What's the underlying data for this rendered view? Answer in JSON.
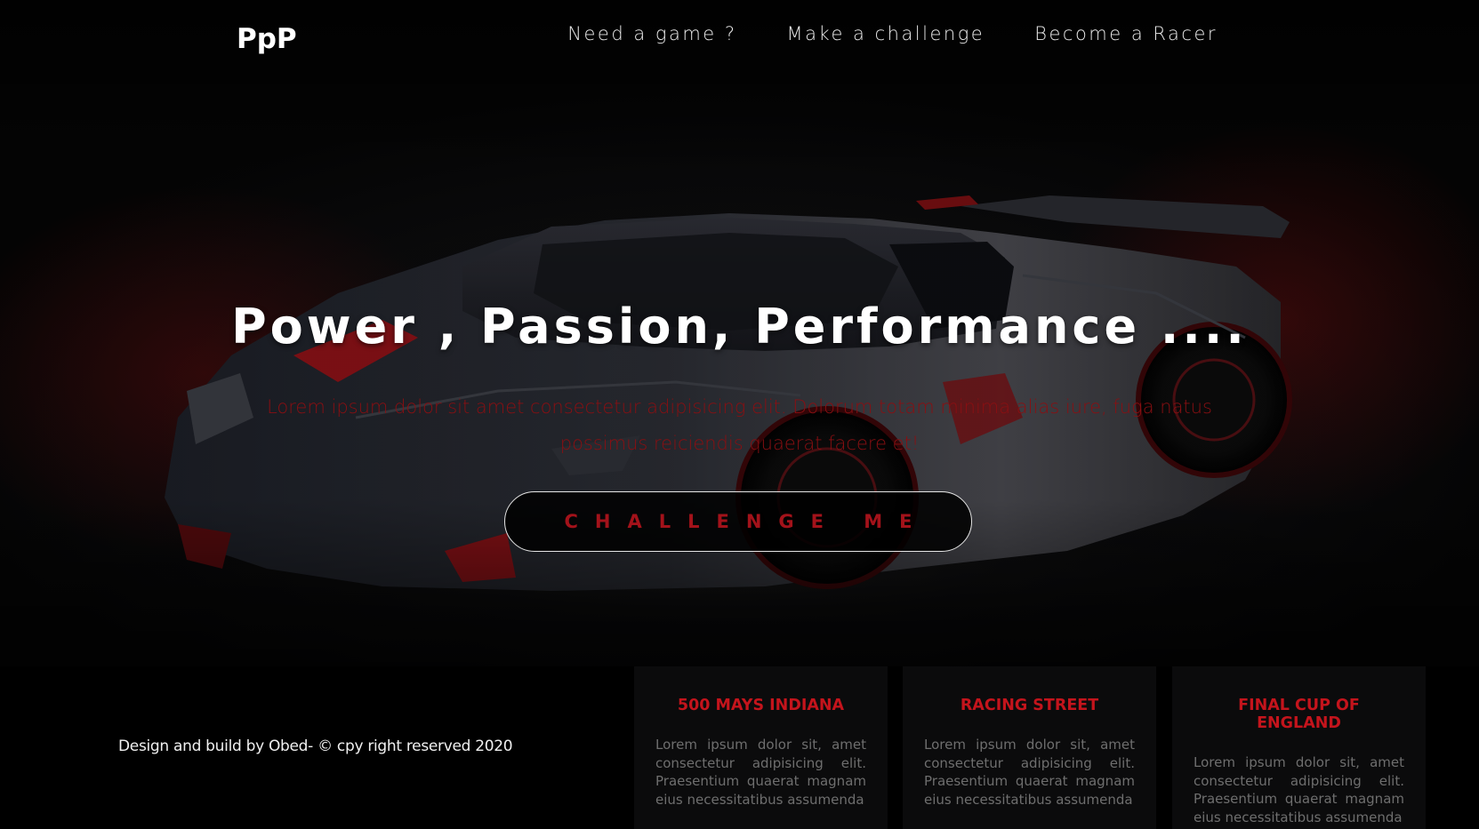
{
  "brand": {
    "logo": "PpP"
  },
  "nav": {
    "items": [
      {
        "label": "Need a game ?"
      },
      {
        "label": "Make a challenge"
      },
      {
        "label": "Become a Racer"
      }
    ]
  },
  "hero": {
    "headline": "Power , Passion, Performance ....",
    "subtext": "Lorem ipsum dolor sit amet consectetur adipisicing elit. Dolorum totam minima alias iure, fuga natus possimus reiciendis quaerat facere et!",
    "cta_label": "CHALLENGE ME",
    "background_image": "sports-car-image"
  },
  "footer": {
    "credit": "Design and build by Obed- © cpy right reserved 2020",
    "cards": [
      {
        "title": "500 MAYS INDIANA",
        "body": "Lorem ipsum dolor sit, amet consectetur adipisicing elit. Praesentium quaerat magnam eius necessitatibus assumenda"
      },
      {
        "title": "RACING STREET",
        "body": "Lorem ipsum dolor sit, amet consectetur adipisicing elit. Praesentium quaerat magnam eius necessitatibus assumenda"
      },
      {
        "title": "FINAL CUP OF ENGLAND",
        "body": "Lorem ipsum dolor sit, amet consectetur adipisicing elit. Praesentium quaerat magnam eius necessitatibus assumenda"
      }
    ]
  },
  "colors": {
    "accent_red": "#c4141c",
    "dark_red_text": "#8a0f12",
    "background": "#000000"
  }
}
